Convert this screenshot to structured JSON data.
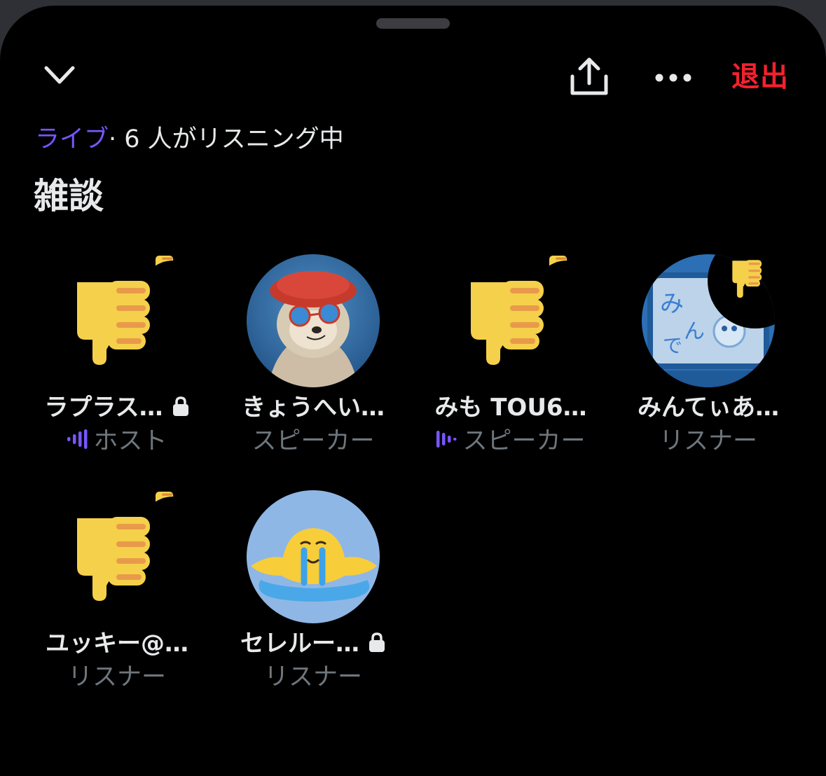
{
  "header": {
    "leave_label": "退出",
    "collapse_icon": "chevron-down-icon",
    "share_icon": "share-icon",
    "more_icon": "more-horizontal-icon"
  },
  "status": {
    "live": "ライブ",
    "listeners": "· 6 人がリスニング中"
  },
  "room": {
    "title": "雑談"
  },
  "participants": [
    {
      "name": "ラプラス…",
      "role": "ホスト",
      "avatar": "thumbs-down-emoji",
      "locked": true,
      "speaking": true
    },
    {
      "name": "きょうへい…",
      "role": "スピーカー",
      "avatar": "sloth-photo",
      "locked": false,
      "speaking": false
    },
    {
      "name": "みも TOU6…",
      "role": "スピーカー",
      "avatar": "thumbs-down-emoji",
      "locked": false,
      "speaking": true
    },
    {
      "name": "みんてぃあ…",
      "role": "リスナー",
      "avatar": "blue-figure-photo",
      "locked": false,
      "speaking": false
    },
    {
      "name": "ユッキー@…",
      "role": "リスナー",
      "avatar": "thumbs-down-emoji",
      "locked": false,
      "speaking": false
    },
    {
      "name": "セレルー…",
      "role": "リスナー",
      "avatar": "melting-crying-face",
      "locked": true,
      "speaking": false
    }
  ],
  "colors": {
    "accent": "#7856ff",
    "leave": "#f4212e",
    "text": "#e7e9ea",
    "muted": "#6e767d",
    "background": "#000000"
  }
}
